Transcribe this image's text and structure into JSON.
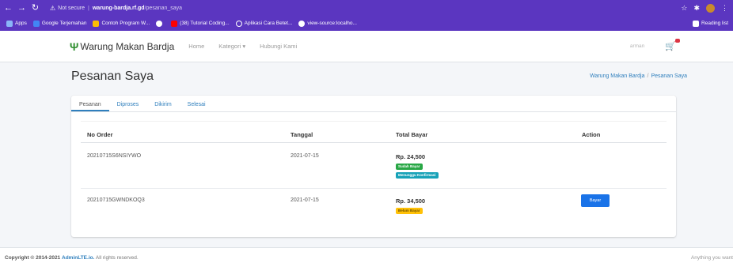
{
  "browser": {
    "not_secure": "Not secure",
    "host": "warung-bardja.rf.gd",
    "path": "/pesanan_saya",
    "bookmarks": [
      {
        "label": "Apps",
        "color": "#8ab4f8"
      },
      {
        "label": "Google Terjemahan",
        "color": "#4285f4"
      },
      {
        "label": "Contoh Program W...",
        "color": "#fbbc04"
      },
      {
        "label": "",
        "color": "#ffffff"
      },
      {
        "label": "(38) Tutorial Coding...",
        "color": "#ff0000"
      },
      {
        "label": "Aplikasi Cara Betet...",
        "color": "#ffffff"
      },
      {
        "label": "view-source:localho...",
        "color": "#ffffff"
      }
    ],
    "reading_list": "Reading list"
  },
  "navbar": {
    "brand": "Warung Makan Bardja",
    "links": [
      "Home",
      "Kategori ▾",
      "Hubungi Kami"
    ],
    "user": "arman"
  },
  "header": {
    "title": "Pesanan Saya",
    "breadcrumb": [
      "Warung Makan Bardja",
      "/",
      "Pesanan Saya"
    ]
  },
  "tabs": [
    "Pesanan",
    "Diproses",
    "Dikirim",
    "Selesai"
  ],
  "table": {
    "columns": [
      "No Order",
      "Tanggal",
      "Total Bayar",
      "Action"
    ],
    "rows": [
      {
        "order": "20210715S6NSIYWO",
        "date": "2021-07-15",
        "total": "Rp. 24,500",
        "badges": [
          "Sudah Bayar",
          "Menunggu Konfirmasi"
        ],
        "action": ""
      },
      {
        "order": "20210715GWNDKOQ3",
        "date": "2021-07-15",
        "total": "Rp. 34,500",
        "badges": [
          "Belum Bayar"
        ],
        "action": "Bayar"
      }
    ]
  },
  "footer": {
    "copyright": "Copyright © 2014-2021",
    "brand": "AdminLTE.io.",
    "rights": "All rights reserved.",
    "right": "Anything you want"
  }
}
